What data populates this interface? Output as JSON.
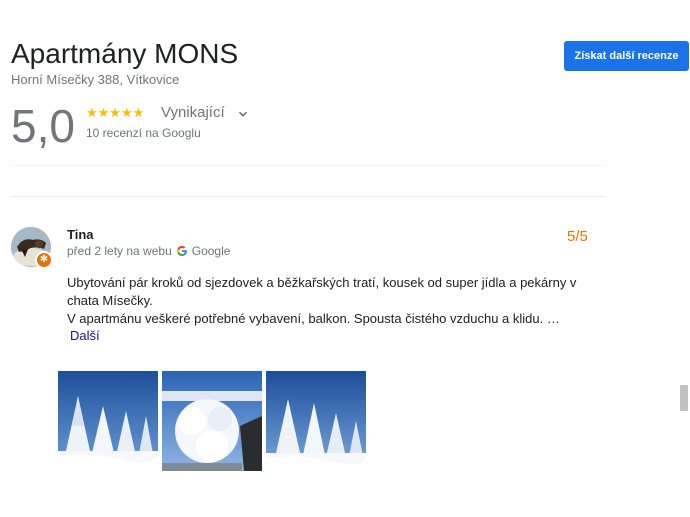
{
  "business": {
    "name": "Apartmány MONS",
    "address": "Horní Mísečky 388, Vítkovice",
    "cta_label": "Získat další recenze"
  },
  "rating": {
    "score": "5,0",
    "stars": "★★★★★",
    "label": "Vynikající",
    "review_count": "10 recenzí na Googlu"
  },
  "review": {
    "author": "Tina",
    "time": "před 2 lety na webu",
    "source": "Google",
    "score": "5/5",
    "text_line1": "Ubytování pár kroků od sjezdovek a běžkařských tratí, kousek od super jídla a pekárny v chata Mísečky.",
    "text_line2": "V apartmánu veškeré potřebné vybavení, balkon. Spousta čistého vzduchu a klidu. …",
    "more_label": "Další",
    "badge_icon": "local-guide-star-icon"
  },
  "colors": {
    "accent": "#1a73e8",
    "star": "#fbbc04",
    "score_orange": "#e37400"
  }
}
